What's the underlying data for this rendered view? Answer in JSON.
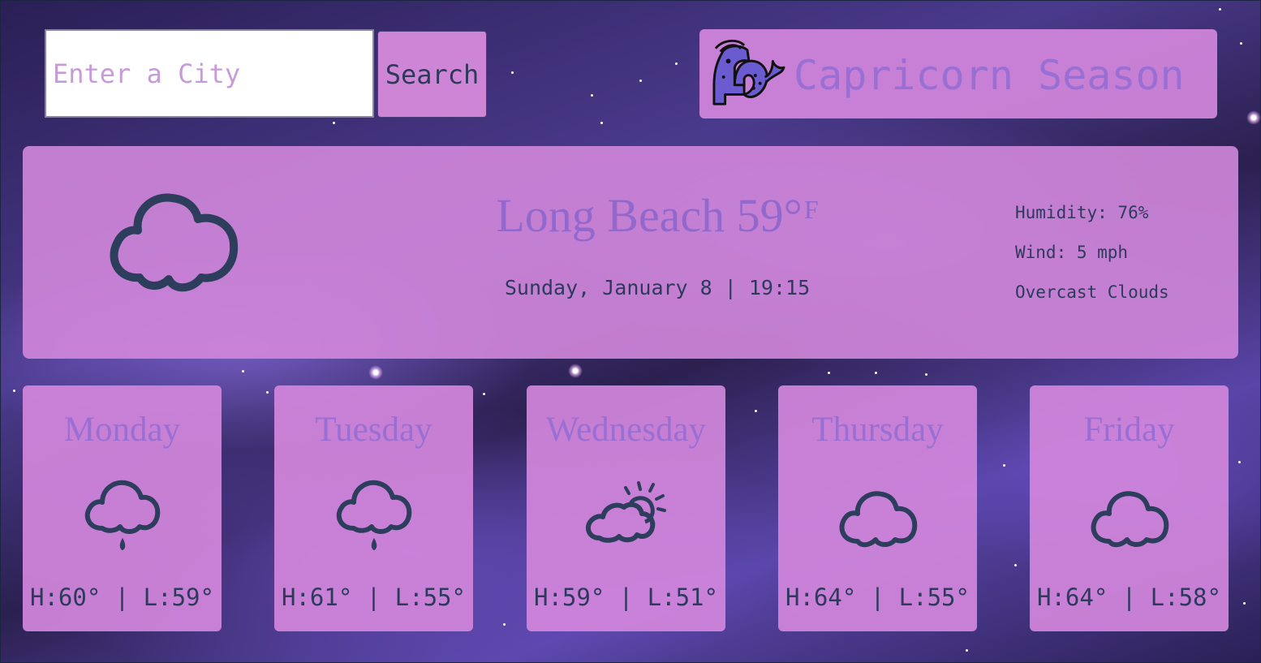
{
  "search": {
    "placeholder": "Enter a City",
    "value": "",
    "button_label": "Search"
  },
  "season": {
    "title": "Capricorn Season",
    "icon": "capricorn-icon"
  },
  "current": {
    "city": "Long Beach",
    "temperature": "59°",
    "unit": "F",
    "datetime": "Sunday, January 8 | 19:15",
    "humidity": "Humidity: 76%",
    "wind": "Wind: 5 mph",
    "description": "Overcast Clouds",
    "icon": "cloud-icon"
  },
  "forecast": [
    {
      "day": "Monday",
      "icon": "rain-icon",
      "temps": "H:60° | L:59°"
    },
    {
      "day": "Tuesday",
      "icon": "rain-icon",
      "temps": "H:61° | L:55°"
    },
    {
      "day": "Wednesday",
      "icon": "partly-cloudy-icon",
      "temps": "H:59° | L:51°"
    },
    {
      "day": "Thursday",
      "icon": "cloud-icon",
      "temps": "H:64° | L:55°"
    },
    {
      "day": "Friday",
      "icon": "cloud-icon",
      "temps": "H:64° | L:58°"
    }
  ],
  "colors": {
    "card": "#d287dc",
    "title_purple": "#9a6fd4",
    "text_dark": "#2d3a5c",
    "icon_stroke": "#2d3d5c"
  }
}
